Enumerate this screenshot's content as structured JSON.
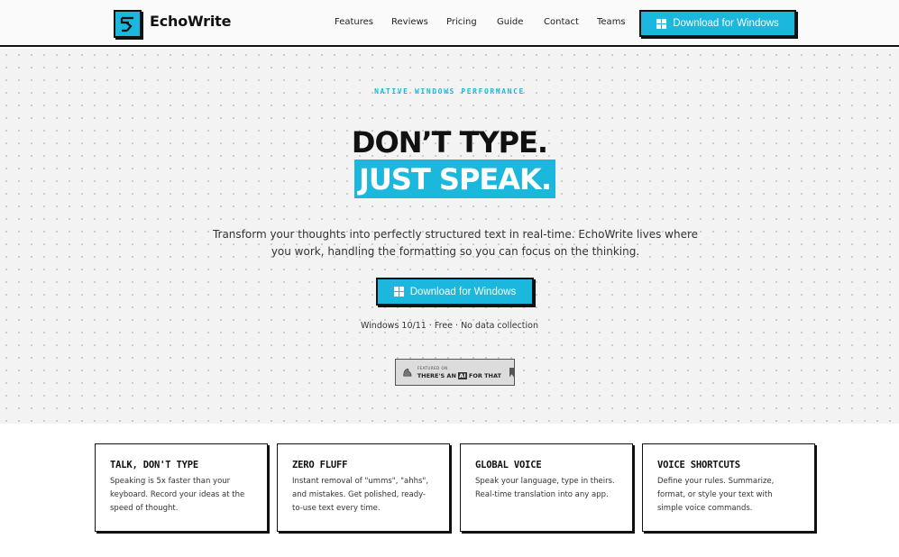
{
  "nav": {
    "brand": "EchoWrite",
    "links": [
      "Features",
      "Reviews",
      "Pricing",
      "Guide",
      "Contact",
      "Teams"
    ],
    "cta_label": "Download for Windows"
  },
  "hero": {
    "eyebrow": "NATIVE WINDOWS PERFORMANCE",
    "headline_line1": "DON’T TYPE.",
    "headline_line2": "JUST SPEAK.",
    "subheadline": "Transform your thoughts into perfectly structured text in real-time. EchoWrite lives where you work, handling the formatting so you can focus on the thinking.",
    "cta_label": "Download for Windows",
    "meta": "Windows 10/11 · Free · No data collection",
    "badge": {
      "small_text": "FEATURED ON",
      "text_pre": "THERE'S AN ",
      "text_ai": "AI",
      "text_post": " FOR THAT"
    }
  },
  "features": [
    {
      "title": "TALK, DON'T TYPE",
      "body": "Speaking is 5x faster than your keyboard. Record your ideas at the speed of thought."
    },
    {
      "title": "ZERO FLUFF",
      "body": "Instant removal of \"umms\", \"ahhs\", and mistakes. Get polished, ready-to-use text every time."
    },
    {
      "title": "GLOBAL VOICE",
      "body": "Speak your language, type in theirs. Real-time translation into any app."
    },
    {
      "title": "VOICE SHORTCUTS",
      "body": "Define your rules. Summarize, format, or style your text with simple voice commands."
    }
  ],
  "colors": {
    "accent": "#1bb7dc",
    "ink": "#111111",
    "hero_bg": "#f3f3f3"
  },
  "icons": {
    "logo": "echowrite-logo-icon",
    "cta": "windows-icon"
  }
}
